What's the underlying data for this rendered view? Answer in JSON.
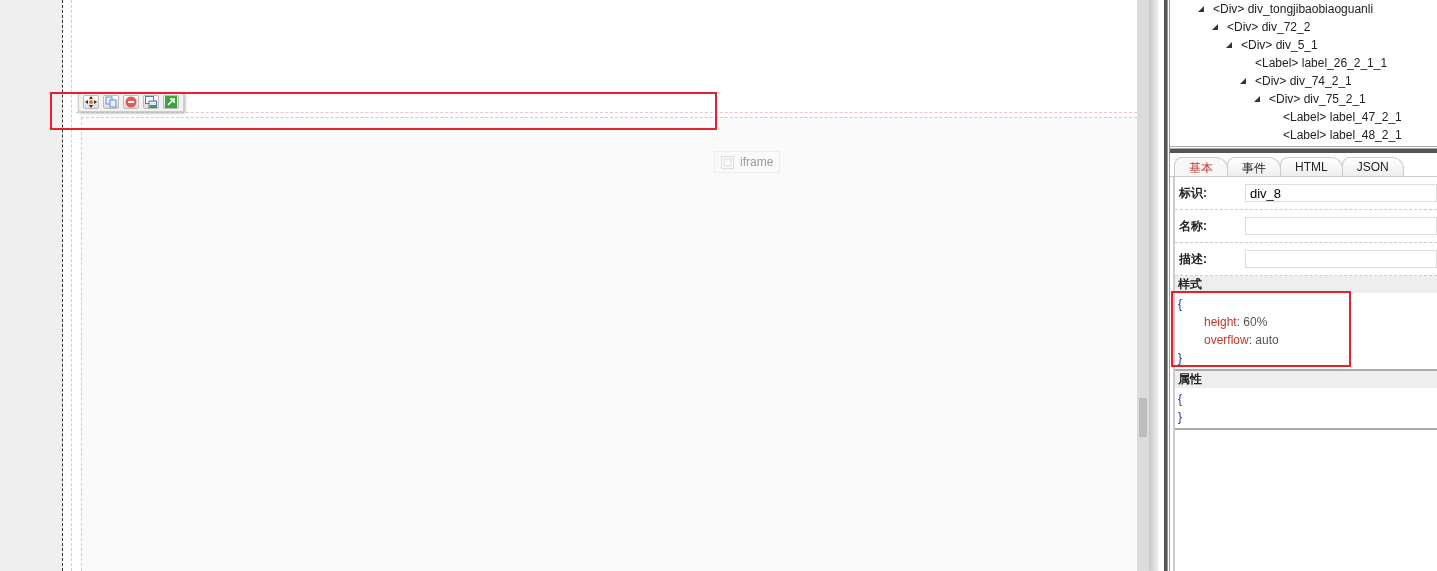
{
  "canvas": {
    "toolbar": {
      "highlighted": true,
      "buttons": [
        {
          "kind": "move"
        },
        {
          "kind": "copy"
        },
        {
          "kind": "delete"
        },
        {
          "kind": "window"
        },
        {
          "kind": "export"
        }
      ]
    },
    "placeholder": {
      "label": "iframe"
    }
  },
  "tree": [
    {
      "tag": "<Div>",
      "name": "div_tongjibaobiaoguanli",
      "expanded": true,
      "children": [
        {
          "tag": "<Div>",
          "name": "div_72_2",
          "expanded": true,
          "children": [
            {
              "tag": "<Div>",
              "name": "div_5_1",
              "expanded": true,
              "children": [
                {
                  "tag": "<Label>",
                  "name": "label_26_2_1_1"
                },
                {
                  "tag": "<Div>",
                  "name": "div_74_2_1",
                  "expanded": true,
                  "children": [
                    {
                      "tag": "<Div>",
                      "name": "div_75_2_1",
                      "expanded": true,
                      "children": [
                        {
                          "tag": "<Label>",
                          "name": "label_47_2_1"
                        },
                        {
                          "tag": "<Label>",
                          "name": "label_48_2_1"
                        }
                      ]
                    }
                  ]
                }
              ]
            }
          ]
        }
      ]
    }
  ],
  "tabs": [
    {
      "label": "基本",
      "selected": true
    },
    {
      "label": "事件",
      "selected": false
    },
    {
      "label": "HTML",
      "selected": false
    },
    {
      "label": "JSON",
      "selected": false
    }
  ],
  "fields": [
    {
      "label": "标识:",
      "value": "div_8"
    },
    {
      "label": "名称:"
    },
    {
      "label": "描述:"
    }
  ],
  "style": {
    "title": "样式",
    "highlighted": true,
    "open": "{",
    "close": "}",
    "entries": [
      {
        "key": "height",
        "sep": ":",
        "value": "60%"
      },
      {
        "key": "overflow",
        "sep": ":",
        "value": "auto"
      }
    ]
  },
  "attributes": {
    "title": "属性",
    "open": "{",
    "close": "}"
  }
}
